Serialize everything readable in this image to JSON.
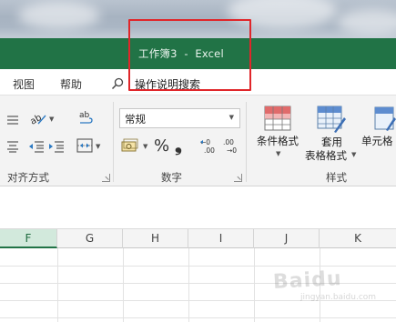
{
  "window": {
    "title": "工作簿3  -  Excel"
  },
  "tabs": [
    {
      "label": "视图"
    },
    {
      "label": "帮助"
    }
  ],
  "search": {
    "label": "操作说明搜索",
    "icon": "search-icon"
  },
  "ribbon": {
    "alignment_group": {
      "label": "对齐方式"
    },
    "number_group": {
      "label": "数字",
      "format_value": "常规",
      "percent_symbol": "%",
      "comma_symbol": "❟"
    },
    "styles_group": {
      "label": "样式",
      "conditional_formatting": "条件格式",
      "format_as_table_line1": "套用",
      "format_as_table_line2": "表格格式",
      "cell_styles": "单元格"
    }
  },
  "sheet": {
    "columns": [
      "F",
      "G",
      "H",
      "I",
      "J",
      "K"
    ],
    "active_column": "F"
  },
  "watermark": {
    "text": "Baidu",
    "subtext": "jingyan.baidu.com"
  },
  "colors": {
    "excel_green": "#217346",
    "annotation_red": "#e0262a",
    "active_header": "#d2e9dc"
  }
}
